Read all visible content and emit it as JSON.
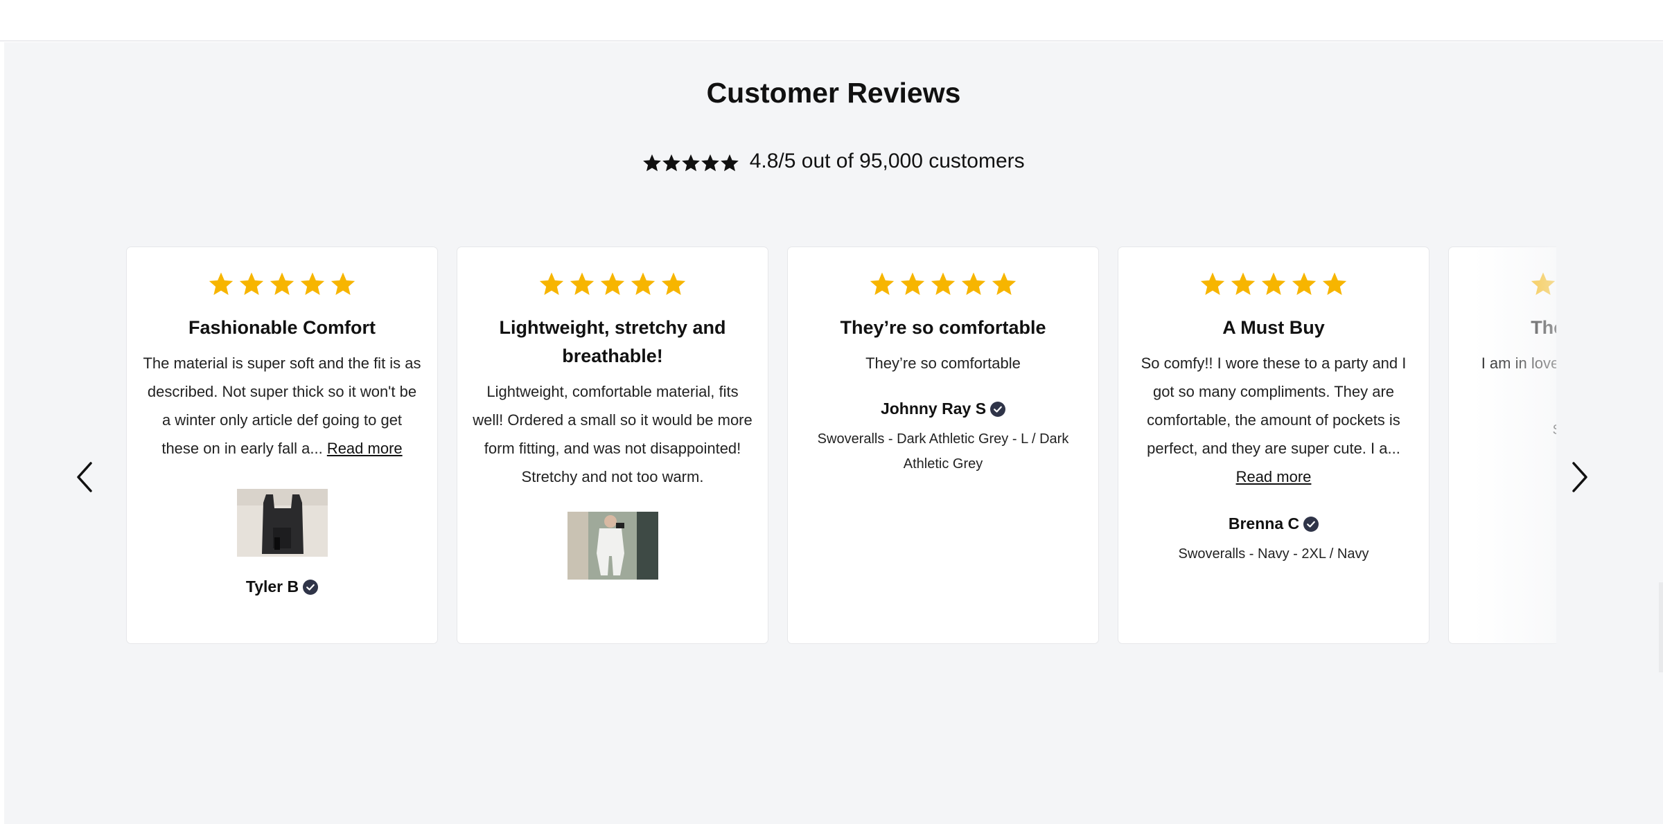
{
  "section": {
    "heading": "Customer Reviews",
    "summary_text": "4.8/5 out of 95,000 customers",
    "summary_stars": 5,
    "star_color_summary": "#111111",
    "star_color_cards": "#f7b500"
  },
  "reviews": [
    {
      "rating": 5,
      "title": "Fashionable Comfort",
      "body": "The material is super soft and the fit is as described. Not super thick so it won't be a winter only article def going to get these on in early fall a...",
      "read_more": "Read more",
      "author": "Tyler B",
      "verified": true,
      "has_photo": true
    },
    {
      "rating": 5,
      "title": "Lightweight, stretchy and breathable!",
      "body": "Lightweight, comfortable material, fits well! Ordered a small so it would be more form fitting, and was not disappointed! Stretchy and not too warm.",
      "has_photo": true
    },
    {
      "rating": 5,
      "title": "They’re so comfortable",
      "body": "They’re so comfortable",
      "author": "Johnny Ray S",
      "verified": true,
      "variant": "Swoveralls - Dark Athletic Grey - L / Dark Athletic Grey"
    },
    {
      "rating": 5,
      "title": "A Must Buy",
      "body": "So comfy!! I wore these to a party and I got so many compliments. They are comfortable, the amount of pockets is perfect, and they are super cute. I a...",
      "read_more": "Read more",
      "author": "Brenna C",
      "verified": true,
      "variant": "Swoveralls - Navy - 2XL / Navy"
    },
    {
      "rating": 5,
      "title": "These ar made a",
      "body": "I am in love has secret p well, they a",
      "variant": "Swovie Short Da"
    }
  ],
  "carousel": {
    "prev_icon": "chevron-left-icon",
    "next_icon": "chevron-right-icon"
  }
}
